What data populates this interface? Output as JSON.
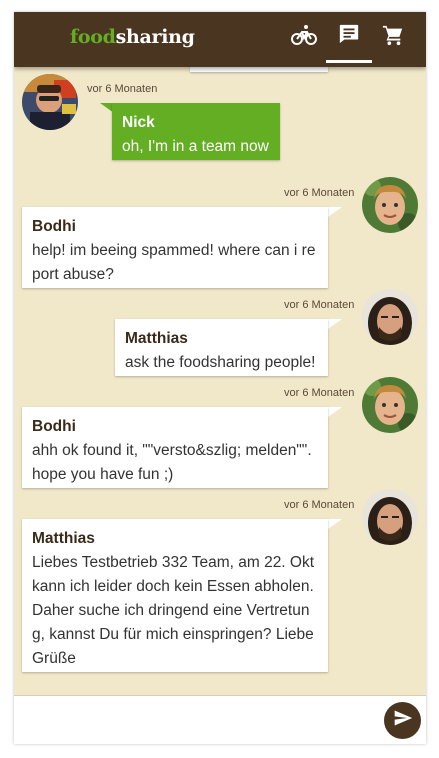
{
  "app": {
    "logo": {
      "part1": "food",
      "part2": "sharing"
    },
    "nav": [
      {
        "icon": "bicycle-icon",
        "active": false
      },
      {
        "icon": "chat-icon",
        "active": true
      },
      {
        "icon": "basket-icon",
        "active": false
      }
    ]
  },
  "messages": [
    {
      "author": "Nick",
      "timestamp": "vor 6 Monaten",
      "text": "oh, I'm in a team now",
      "own": true
    },
    {
      "author": "Bodhi",
      "timestamp": "vor 6 Monaten",
      "text": "help! im beeing spammed! where can i re port abuse?",
      "own": false
    },
    {
      "author": "Matthias",
      "timestamp": "vor 6 Monaten",
      "text": "ask the foodsharing people!",
      "own": false
    },
    {
      "author": "Bodhi",
      "timestamp": "vor 6 Monaten",
      "text": "ahh ok found it, \"\"versto&szlig; melden\"\". hope you have fun ;)",
      "own": false
    },
    {
      "author": "Matthias",
      "timestamp": "vor 6 Monaten",
      "text": "Liebes Testbetrieb 332 Team, am 22. Okt kann ich leider doch kein Essen abholen. Daher suche ich dringend eine Vertretun g, kannst Du für mich einspringen? Liebe Grüße",
      "own": false
    }
  ],
  "composer": {
    "placeholder": "",
    "value": ""
  },
  "colors": {
    "brand_brown": "#4a3520",
    "brand_green": "#64ae24",
    "background": "#f1e7c9"
  }
}
